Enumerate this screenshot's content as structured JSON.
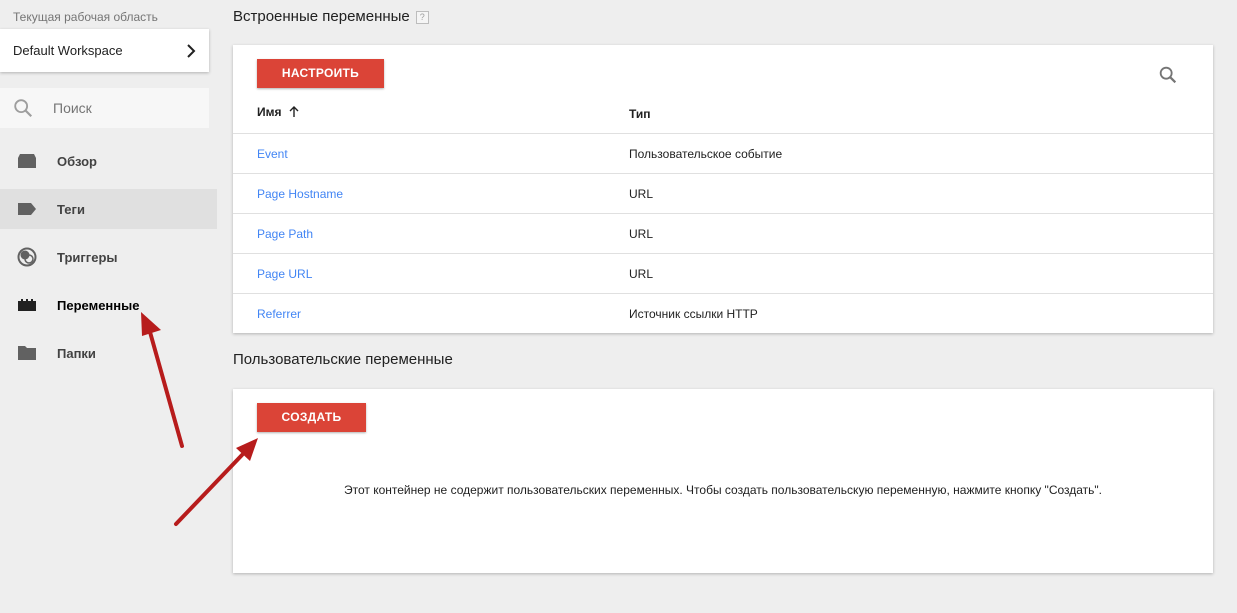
{
  "sidebar": {
    "workspace_label": "Текущая рабочая область",
    "workspace_name": "Default Workspace",
    "search_placeholder": "Поиск",
    "items": [
      {
        "label": "Обзор",
        "icon": "overview-icon"
      },
      {
        "label": "Теги",
        "icon": "tag-icon"
      },
      {
        "label": "Триггеры",
        "icon": "trigger-icon"
      },
      {
        "label": "Переменные",
        "icon": "variables-icon"
      },
      {
        "label": "Папки",
        "icon": "folder-icon"
      }
    ]
  },
  "builtin": {
    "title": "Встроенные переменные",
    "help": "?",
    "configure_button": "НАСТРОИТЬ",
    "columns": {
      "name": "Имя",
      "type": "Тип"
    },
    "rows": [
      {
        "name": "Event",
        "type": "Пользовательское событие"
      },
      {
        "name": "Page Hostname",
        "type": "URL"
      },
      {
        "name": "Page Path",
        "type": "URL"
      },
      {
        "name": "Page URL",
        "type": "URL"
      },
      {
        "name": "Referrer",
        "type": "Источник ссылки HTTP"
      }
    ]
  },
  "custom": {
    "title": "Пользовательские переменные",
    "create_button": "СОЗДАТЬ",
    "empty_message": "Этот контейнер не содержит пользовательских переменных. Чтобы создать пользовательскую переменную, нажмите кнопку \"Создать\"."
  },
  "colors": {
    "accent_red": "#db4437",
    "link_blue": "#4285f4",
    "annotation_arrow": "#b71c1c"
  }
}
